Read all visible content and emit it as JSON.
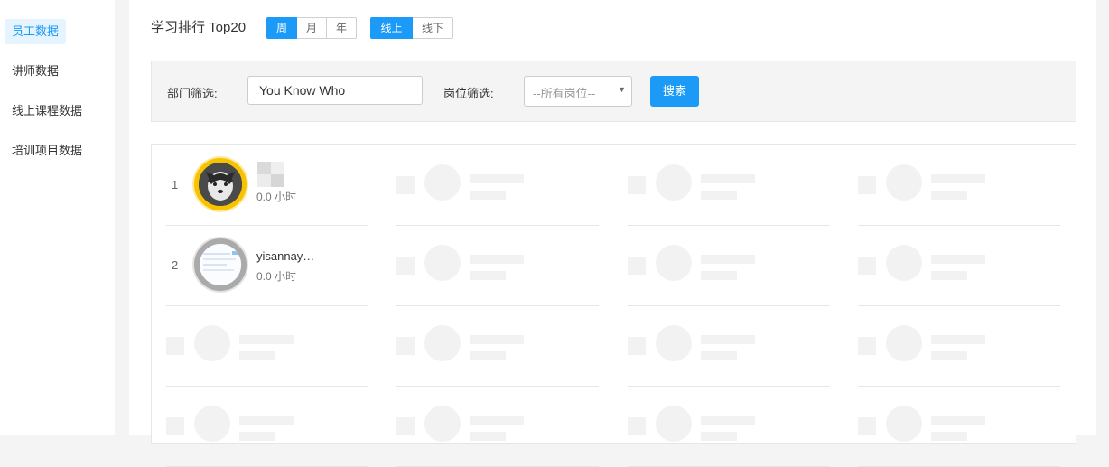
{
  "sidebar": {
    "items": [
      {
        "label": "员工数据",
        "active": true
      },
      {
        "label": "讲师数据",
        "active": false
      },
      {
        "label": "线上课程数据",
        "active": false
      },
      {
        "label": "培训项目数据",
        "active": false
      }
    ]
  },
  "header": {
    "title": "学习排行 Top20",
    "period_options": [
      "周",
      "月",
      "年"
    ],
    "period_selected": "周",
    "mode_options": [
      "线上",
      "线下"
    ],
    "mode_selected": "线上"
  },
  "filter": {
    "dept_label": "部门筛选:",
    "dept_value": "You Know Who",
    "position_label": "岗位筛选:",
    "position_value": "--所有岗位--",
    "search_label": "搜索"
  },
  "ranking": [
    {
      "rank": "1",
      "name": "",
      "hours": "0.0 小时"
    },
    {
      "rank": "2",
      "name": "yisannay…",
      "hours": "0.0 小时"
    }
  ],
  "colors": {
    "accent": "#1b9af7",
    "gold_ring": "#f7c300",
    "silver_ring": "#aaaaaa"
  }
}
